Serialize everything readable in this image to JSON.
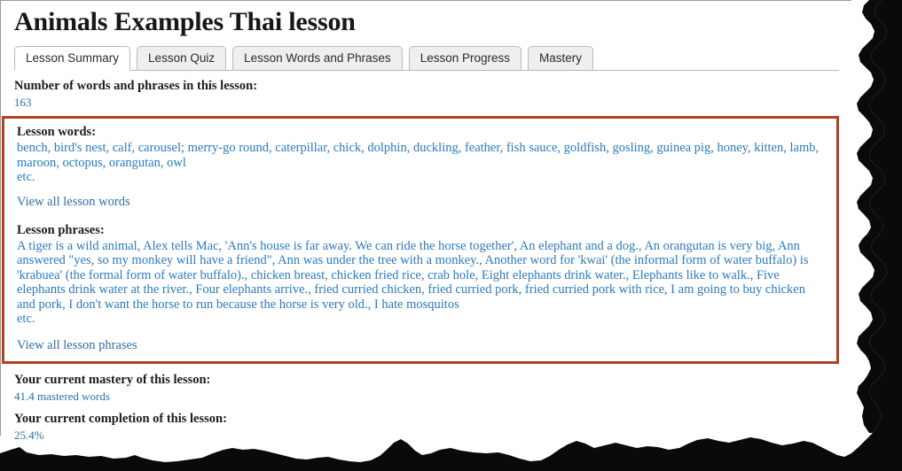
{
  "page": {
    "title": "Animals Examples Thai lesson"
  },
  "tabs": [
    {
      "label": "Lesson Summary",
      "active": true
    },
    {
      "label": "Lesson Quiz",
      "active": false
    },
    {
      "label": "Lesson Words and Phrases",
      "active": false
    },
    {
      "label": "Lesson Progress",
      "active": false
    },
    {
      "label": "Mastery",
      "active": false
    }
  ],
  "summary": {
    "count_label": "Number of words and phrases in this lesson:",
    "count_value": "163",
    "words_label": "Lesson words:",
    "words_text": "bench, bird's nest, calf, carousel; merry-go round, caterpillar, chick, dolphin, duckling, feather, fish sauce, goldfish, gosling, guinea pig, honey, kitten, lamb, maroon, octopus, orangutan, owl",
    "words_etc": "etc.",
    "words_link": "View all lesson words",
    "phrases_label": "Lesson phrases:",
    "phrases_text": "A tiger is a wild animal, Alex tells Mac, 'Ann's house is far away. We can ride the horse together', An elephant and a dog., An orangutan is very big, Ann answered \"yes, so my monkey will have a friend\", Ann was under the tree with a monkey., Another word for 'kwai' (the informal form of water buffalo) is 'krabuea' (the formal form of water buffalo)., chicken breast, chicken fried rice, crab hole, Eight elephants drink water., Elephants like to walk., Five elephants drink water at the river., Four elephants arrive., fried curried chicken, fried curried pork, fried curried pork with rice, I am going to buy chicken and pork, I don't want the horse to run because the horse is very old., I hate mosquitos",
    "phrases_etc": "etc.",
    "phrases_link": "View all lesson phrases",
    "mastery_label": "Your current mastery of this lesson:",
    "mastery_value": "41.4 mastered words",
    "completion_label": "Your current completion of this lesson:",
    "completion_value": "25.4%"
  },
  "colors": {
    "highlight_border": "#b04122",
    "link": "#2f6fa8",
    "list_text": "#2b7ac0",
    "heading": "#1c1c1c",
    "torn_edge": "#0a0a0a"
  },
  "decorations": {
    "torn_edge_name": "torn-paper-edge"
  }
}
